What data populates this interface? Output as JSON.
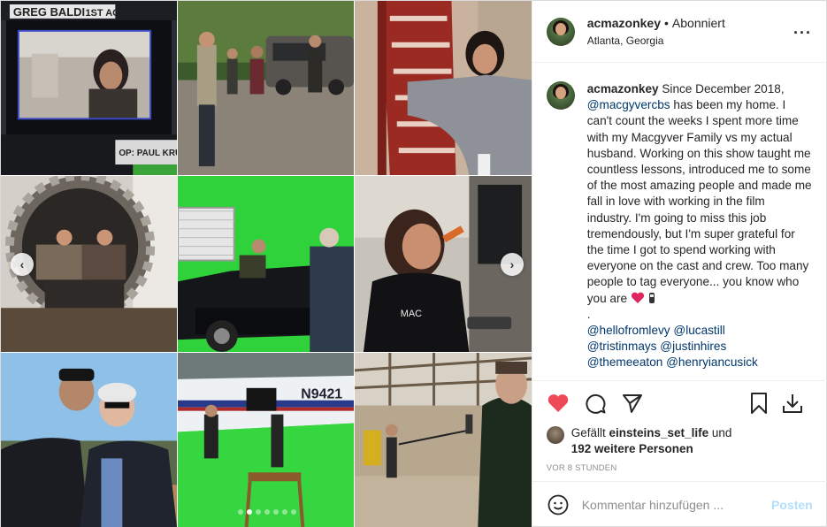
{
  "header": {
    "username": "acmazonkey",
    "separator": "•",
    "follow_status": "Abonniert",
    "location": "Atlanta, Georgia",
    "more_icon": "more-horizontal-icon"
  },
  "caption": {
    "username": "acmazonkey",
    "text_before_mention": "Since December 2018,",
    "mention_1": "@macgyvercbs",
    "text_after_mention": "has been my home. I can't count the weeks I spent more time with my Macgyver Family vs my actual husband. Working on this show taught me countless lessons, introduced me to some of the most amazing people and made me fall in love with working in the film industry. I'm going to miss this job tremendously, but I'm super grateful for the time I got to spend working with everyone on the cast and crew. Too many people to tag everyone... you know who you are",
    "dot_line": ".",
    "tags": [
      [
        "@hellofromlevy",
        "@lucastill"
      ],
      [
        "@tristinmays",
        "@justinhires"
      ],
      [
        "@themeeaton",
        "@henryiancusick"
      ]
    ]
  },
  "actions": {
    "like_icon": "heart-filled-icon",
    "comment_icon": "comment-icon",
    "share_icon": "paper-plane-icon",
    "save_icon": "bookmark-icon",
    "download_icon": "download-icon"
  },
  "likes": {
    "prefix": "Gefällt",
    "liker": "einsteins_set_life",
    "middle": "und",
    "others": "192 weitere Personen"
  },
  "timestamp": "VOR 8 STUNDEN",
  "comment": {
    "placeholder": "Kommentar hinzufügen ...",
    "post_label": "Posten",
    "emoji_icon": "smiley-icon"
  },
  "carousel": {
    "slide_count": 7,
    "active_index": 1,
    "prev_icon": "chevron-left-icon",
    "next_icon": "chevron-right-icon"
  },
  "photo_overlay_text": {
    "slate_name": "GREG BALDI",
    "slate_role": "1ST AC",
    "monitor_op": "OP: PAUL KRUMR",
    "plane_tail": "N9421"
  },
  "colors": {
    "like_red": "#ed4956",
    "mention_blue": "#00376b",
    "post_disabled": "#b2dffc",
    "muted": "#8e8e8e"
  }
}
